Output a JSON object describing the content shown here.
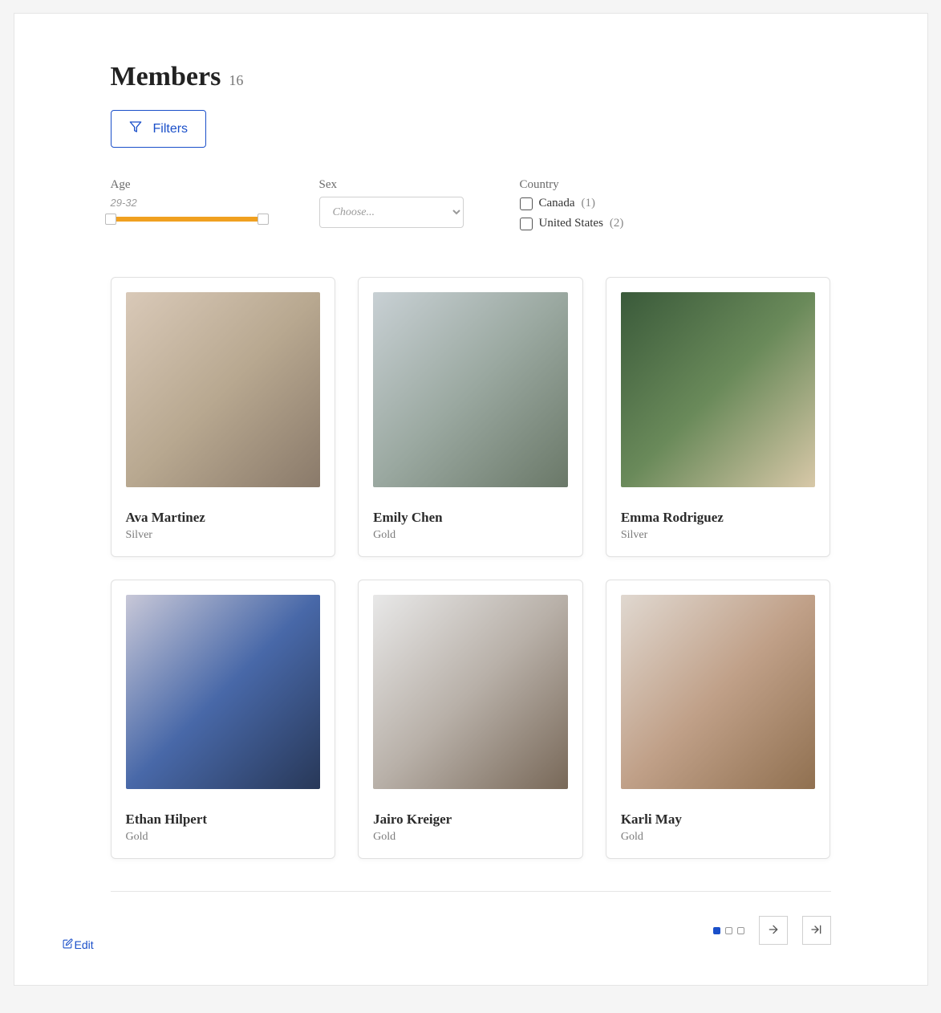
{
  "header": {
    "title": "Members",
    "count": "16"
  },
  "filters_button": "Filters",
  "filters": {
    "age": {
      "label": "Age",
      "range_text": "29-32"
    },
    "sex": {
      "label": "Sex",
      "placeholder": "Choose..."
    },
    "country": {
      "label": "Country",
      "options": [
        {
          "name": "Canada",
          "count": "(1)"
        },
        {
          "name": "United States",
          "count": "(2)"
        }
      ]
    }
  },
  "members": [
    {
      "name": "Ava Martinez",
      "tier": "Silver",
      "img_class": "p1"
    },
    {
      "name": "Emily Chen",
      "tier": "Gold",
      "img_class": "p2"
    },
    {
      "name": "Emma Rodriguez",
      "tier": "Silver",
      "img_class": "p3"
    },
    {
      "name": "Ethan Hilpert",
      "tier": "Gold",
      "img_class": "p4"
    },
    {
      "name": "Jairo Kreiger",
      "tier": "Gold",
      "img_class": "p5"
    },
    {
      "name": "Karli May",
      "tier": "Gold",
      "img_class": "p6"
    }
  ],
  "pagination": {
    "pages": 3,
    "current": 1
  },
  "edit_label": "Edit"
}
